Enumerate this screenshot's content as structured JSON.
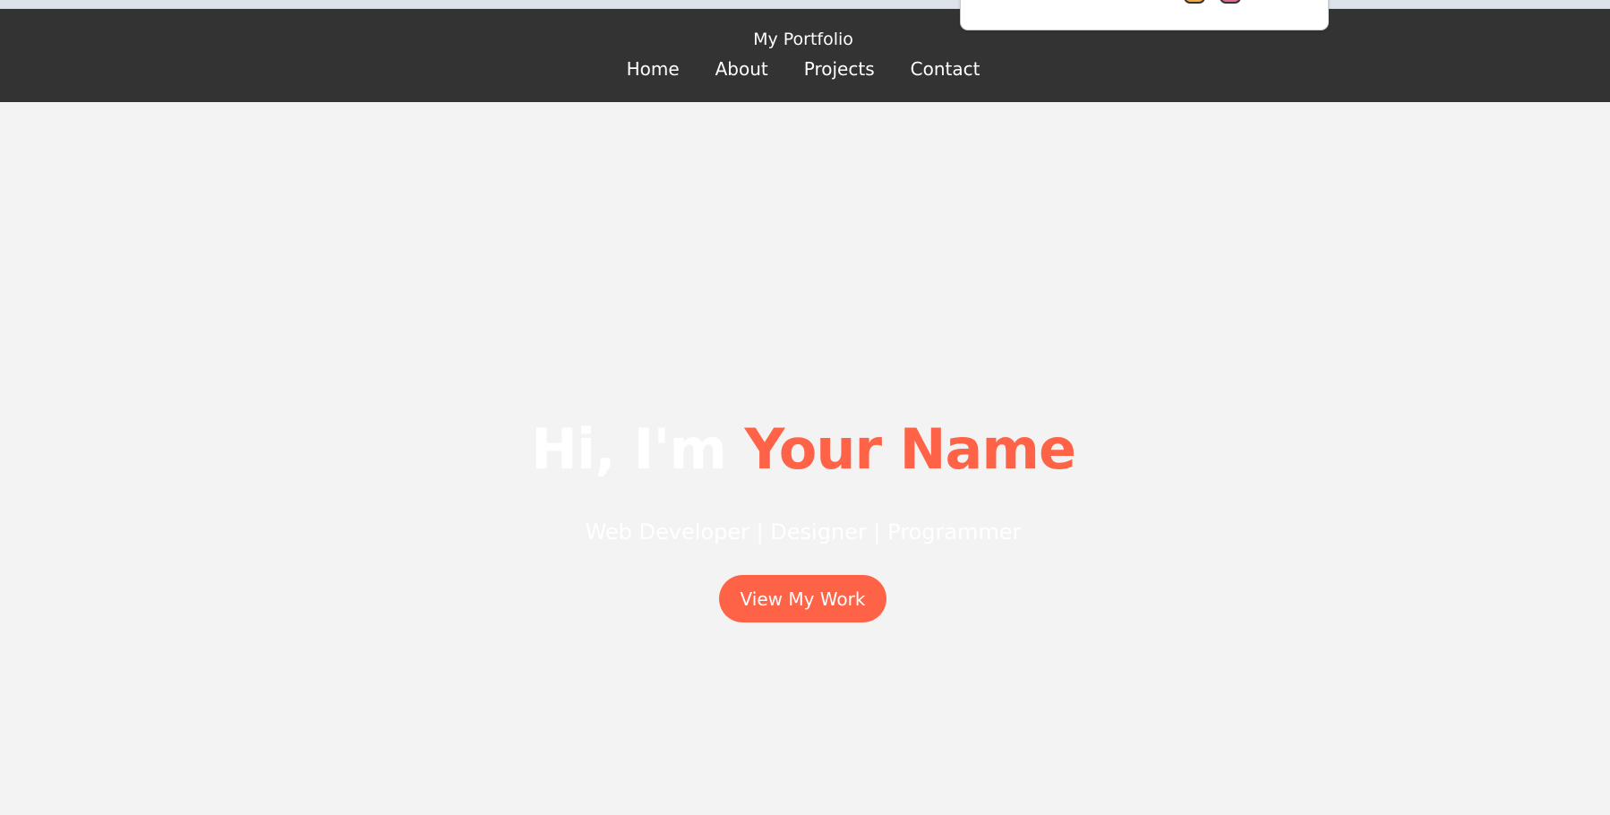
{
  "navbar": {
    "brand": "My Portfolio",
    "links": [
      "Home",
      "About",
      "Projects",
      "Contact"
    ]
  },
  "hero": {
    "title_prefix": "Hi, I'm",
    "title_name": "Your Name",
    "subtitle": "Web Developer | Designer | Programmer",
    "cta_label": "View My Work"
  },
  "colors": {
    "navbar_bg": "#333333",
    "page_bg": "#f3f3f3",
    "accent": "#ff6347",
    "text_light": "#ffffff"
  },
  "overlay": {
    "icons": [
      "extension-icon-orange",
      "extension-icon-pink"
    ]
  }
}
